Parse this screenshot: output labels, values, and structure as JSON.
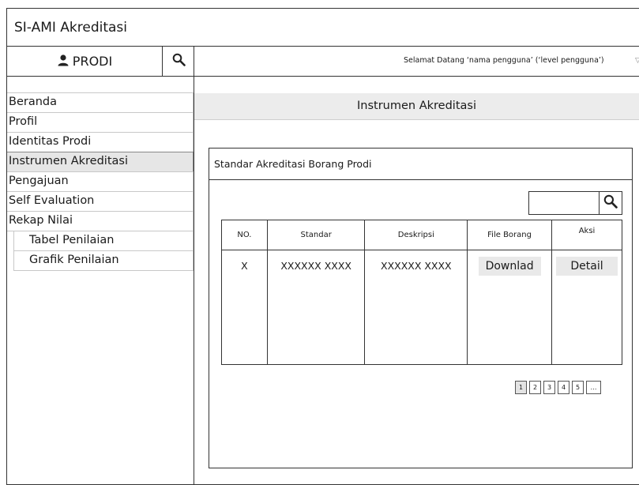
{
  "app": {
    "title": "SI-AMI Akreditasi"
  },
  "sidebar": {
    "user_label": "PRODI",
    "user_icon": "user-icon",
    "search_icon": "search-icon",
    "items": [
      {
        "label": "Beranda",
        "active": false
      },
      {
        "label": "Profil",
        "active": false
      },
      {
        "label": "Identitas Prodi",
        "active": false
      },
      {
        "label": "Instrumen Akreditasi",
        "active": true
      },
      {
        "label": "Pengajuan",
        "active": false
      },
      {
        "label": "Self Evaluation",
        "active": false
      },
      {
        "label": "Rekap Nilai",
        "active": false
      }
    ],
    "subitems": [
      {
        "label": "Tabel Penilaian"
      },
      {
        "label": "Grafik Penilaian"
      }
    ]
  },
  "topbar": {
    "welcome": "Selamat Datang ‘nama pengguna’ (‘level pengguna’)",
    "dropdown_icon": "triangle-down-icon"
  },
  "main": {
    "heading": "Instrumen Akreditasi",
    "card_title": "Standar Akreditasi Borang Prodi",
    "search": {
      "value": "",
      "placeholder": ""
    },
    "table": {
      "headers": [
        "NO.",
        "Standar",
        "Deskripsi",
        "File Borang",
        "Aksi"
      ],
      "rows": [
        {
          "no": "X",
          "standar": "XXXXXX XXXX",
          "deskripsi": "XXXXXX XXXX",
          "file_btn": "Downlad",
          "aksi_btn": "Detail"
        }
      ]
    },
    "pagination": {
      "pages": [
        "1",
        "2",
        "3",
        "4",
        "5"
      ],
      "more": "…",
      "current": "1"
    }
  },
  "colors": {
    "active_menu": "#e6e6e6",
    "button_bg": "#e9e9e9",
    "heading_bar": "#ececec",
    "border": "#333333"
  }
}
